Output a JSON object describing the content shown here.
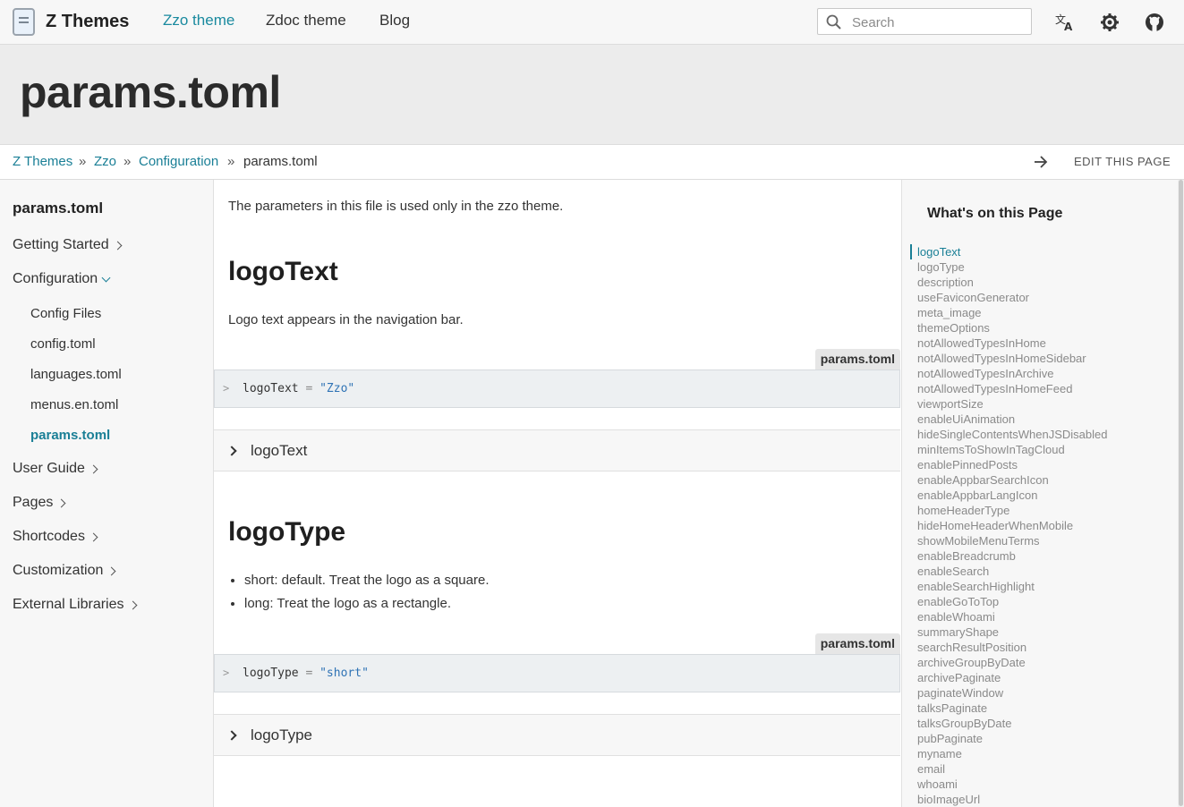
{
  "header": {
    "logo_text": "Z Themes",
    "nav": [
      {
        "label": "Zzo theme",
        "active": true
      },
      {
        "label": "Zdoc theme",
        "active": false
      },
      {
        "label": "Blog",
        "active": false
      }
    ],
    "search_placeholder": "Search",
    "icons": [
      "translate-icon",
      "gear-icon",
      "github-icon"
    ],
    "accent_color": "#1a8a9f"
  },
  "page": {
    "title": "params.toml"
  },
  "breadcrumb": {
    "items": [
      "Z Themes",
      "Zzo",
      "Configuration",
      "params.toml"
    ],
    "separator": "»",
    "edit_label": "EDIT THIS PAGE"
  },
  "sidebar": {
    "title": "params.toml",
    "sections": [
      {
        "label": "Getting Started"
      },
      {
        "label": "Configuration"
      },
      {
        "label": "User Guide"
      },
      {
        "label": "Pages"
      },
      {
        "label": "Shortcodes"
      },
      {
        "label": "Customization"
      },
      {
        "label": "External Libraries"
      }
    ],
    "config_children": [
      "Config Files",
      "config.toml",
      "languages.toml",
      "menus.en.toml",
      "params.toml"
    ],
    "active_child": "params.toml"
  },
  "content": {
    "intro": "The parameters in this file is used only in the zzo theme.",
    "sections": [
      {
        "heading": "logoText",
        "text": "Logo text appears in the navigation bar.",
        "code_tab": "params.toml",
        "code_key": "logoText",
        "code_eq": "=",
        "code_value": "\"Zzo\"",
        "expander": "logoText"
      },
      {
        "heading": "logoType",
        "bullets": [
          "short: default. Treat the logo as a square.",
          "long: Treat the logo as a rectangle."
        ],
        "code_tab": "params.toml",
        "code_key": "logoType",
        "code_eq": "=",
        "code_value": "\"short\"",
        "expander": "logoType"
      }
    ]
  },
  "toc": {
    "title": "What's on this Page",
    "active": "logoText",
    "items": [
      "logoText",
      "logoType",
      "description",
      "useFaviconGenerator",
      "meta_image",
      "themeOptions",
      "notAllowedTypesInHome",
      "notAllowedTypesInHomeSidebar",
      "notAllowedTypesInArchive",
      "notAllowedTypesInHomeFeed",
      "viewportSize",
      "enableUiAnimation",
      "hideSingleContentsWhenJSDisabled",
      "minItemsToShowInTagCloud",
      "enablePinnedPosts",
      "enableAppbarSearchIcon",
      "enableAppbarLangIcon",
      "homeHeaderType",
      "hideHomeHeaderWhenMobile",
      "showMobileMenuTerms",
      "enableBreadcrumb",
      "enableSearch",
      "enableSearchHighlight",
      "enableGoToTop",
      "enableWhoami",
      "summaryShape",
      "searchResultPosition",
      "archiveGroupByDate",
      "archivePaginate",
      "paginateWindow",
      "talksPaginate",
      "talksGroupByDate",
      "pubPaginate",
      "myname",
      "email",
      "whoami",
      "bioImageUrl"
    ]
  }
}
